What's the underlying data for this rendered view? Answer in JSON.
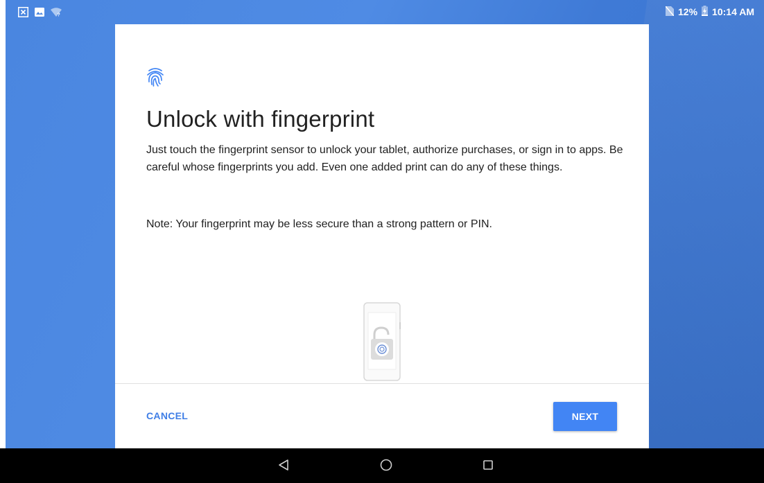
{
  "status_bar": {
    "battery_percent": "12%",
    "time": "10:14 AM",
    "icons": [
      "screenshot-icon",
      "image-icon",
      "wifi-question-icon",
      "no-sim-icon",
      "battery-charging-icon"
    ]
  },
  "setup": {
    "icon": "fingerprint-icon",
    "title": "Unlock with fingerprint",
    "description": "Just touch the fingerprint sensor to unlock your tablet, authorize purchases, or sign in to apps. Be careful whose fingerprints you add. Even one added print can do any of these things.",
    "note": "Note: Your fingerprint may be less secure than a strong pattern or PIN.",
    "illustration": "tablet-unlock-fingerprint-illustration"
  },
  "actions": {
    "cancel_label": "CANCEL",
    "next_label": "NEXT"
  },
  "navbar": {
    "buttons": [
      "back-icon",
      "home-icon",
      "recents-icon"
    ]
  },
  "colors": {
    "background": "#4a86e0",
    "accent": "#4285f4",
    "navbar": "#000000"
  }
}
